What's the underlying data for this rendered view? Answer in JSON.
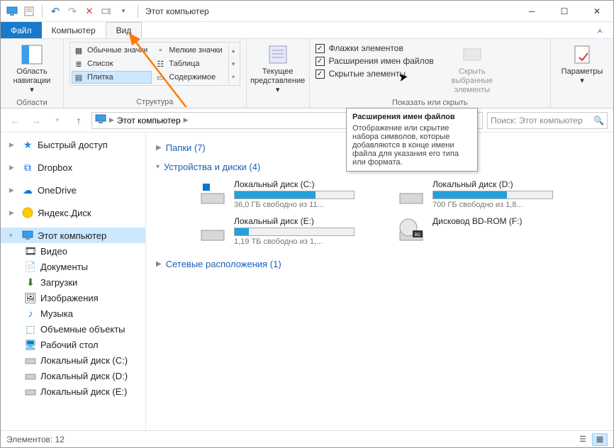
{
  "title": "Этот компьютер",
  "tabs": {
    "file": "Файл",
    "computer": "Компьютер",
    "view": "Вид"
  },
  "ribbon": {
    "nav_panel": "Область навигации",
    "areas_label": "Области",
    "layouts": {
      "regular_icons": "Обычные значки",
      "small_icons": "Мелкие значки",
      "list": "Список",
      "table": "Таблица",
      "tiles": "Плитка",
      "content": "Содержимое"
    },
    "structure_label": "Структура",
    "current_view": "Текущее представление",
    "flags": "Флажки элементов",
    "extensions": "Расширения имен файлов",
    "hidden": "Скрытые элементы",
    "show_hide_label": "Показать или скрыть",
    "hide_selected": "Скрыть выбранные элементы",
    "params": "Параметры"
  },
  "breadcrumb": {
    "current": "Этот компьютер"
  },
  "search_placeholder": "Поиск: Этот компьютер",
  "tooltip": {
    "title": "Расширения имен файлов",
    "body": "Отображение или скрытие набора символов, которые добавляются в конце имени файла для указания его типа или формата."
  },
  "nav": {
    "quick": "Быстрый доступ",
    "dropbox": "Dropbox",
    "onedrive": "OneDrive",
    "yandex": "Яндекс.Диск",
    "thispc": "Этот компьютер",
    "video": "Видео",
    "documents": "Документы",
    "downloads": "Загрузки",
    "pictures": "Изображения",
    "music": "Музыка",
    "objects3d": "Объемные объекты",
    "desktop": "Рабочий стол",
    "local_c": "Локальный диск (C:)",
    "local_d": "Локальный диск (D:)",
    "local_e": "Локальный диск (E:)"
  },
  "sections": {
    "folders": "Папки (7)",
    "drives": "Устройства и диски (4)",
    "network": "Сетевые расположения (1)"
  },
  "drives": {
    "c": {
      "name": "Локальный диск (C:)",
      "free": "36,0 ГБ свободно из 11...",
      "fill": 68
    },
    "d": {
      "name": "Локальный диск (D:)",
      "free": "700 ГБ свободно из 1,8...",
      "fill": 62
    },
    "e": {
      "name": "Локальный диск (E:)",
      "free": "1,19 ТБ свободно из 1,...",
      "fill": 12
    },
    "f": {
      "name": "Дисковод BD-ROM (F:)"
    }
  },
  "status": "Элементов: 12"
}
